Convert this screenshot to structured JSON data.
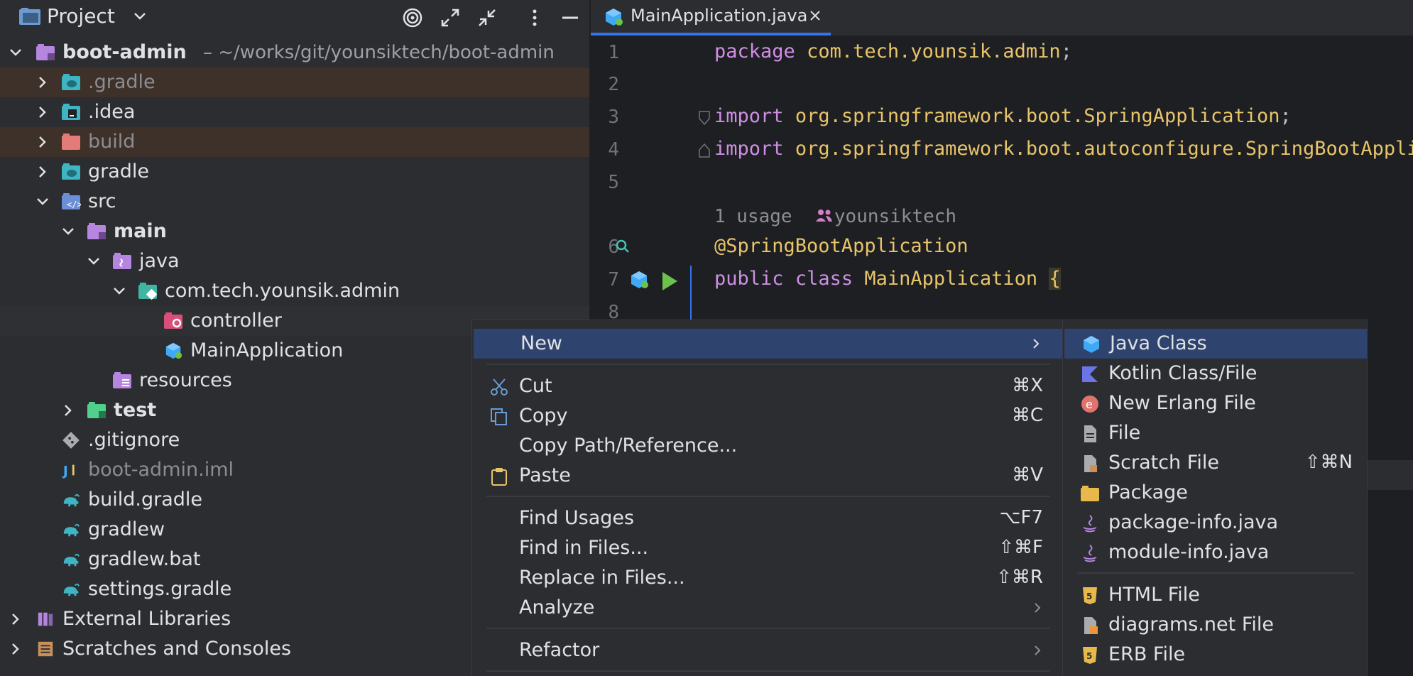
{
  "panel": {
    "title": "Project"
  },
  "tree": [
    {
      "label": "boot-admin",
      "path": "– ~/works/git/younsiktech/boot-admin",
      "bold": true
    },
    {
      "label": ".gradle"
    },
    {
      "label": ".idea"
    },
    {
      "label": "build"
    },
    {
      "label": "gradle"
    },
    {
      "label": "src"
    },
    {
      "label": "main"
    },
    {
      "label": "java"
    },
    {
      "label": "com.tech.younsik.admin"
    },
    {
      "label": "controller"
    },
    {
      "label": "MainApplication"
    },
    {
      "label": "resources"
    },
    {
      "label": "test"
    },
    {
      "label": ".gitignore"
    },
    {
      "label": "boot-admin.iml"
    },
    {
      "label": "build.gradle"
    },
    {
      "label": "gradlew"
    },
    {
      "label": "gradlew.bat"
    },
    {
      "label": "settings.gradle"
    },
    {
      "label": "External Libraries"
    },
    {
      "label": "Scratches and Consoles"
    }
  ],
  "editor": {
    "tab_label": "MainApplication.java",
    "line_numbers": [
      "1",
      "2",
      "3",
      "4",
      "5",
      "6",
      "7",
      "8"
    ],
    "code": {
      "l1_kw": "package",
      "l1_pkg": "com.tech.younsik.admin",
      "l1_end": ";",
      "l3_kw": "import",
      "l3_pkg": "org.springframework.boot.SpringApplication",
      "l3_end": ";",
      "l4_kw": "import",
      "l4_pkg": "org.springframework.boot.autoconfigure.SpringBootApplic",
      "inlay_usage": "1 usage",
      "inlay_author": "younsiktech",
      "l6_annotation": "@SpringBootApplication",
      "l7_kw1": "public",
      "l7_kw2": "class",
      "l7_cls": "MainApplication",
      "l7_brace": "{"
    }
  },
  "context_menu": {
    "new": "New",
    "cut": "Cut",
    "cut_sc": "⌘X",
    "copy": "Copy",
    "copy_sc": "⌘C",
    "copy_path": "Copy Path/Reference...",
    "paste": "Paste",
    "paste_sc": "⌘V",
    "find_usages": "Find Usages",
    "find_usages_sc": "⌥F7",
    "find_files": "Find in Files...",
    "find_files_sc": "⇧⌘F",
    "replace_files": "Replace in Files...",
    "replace_files_sc": "⇧⌘R",
    "analyze": "Analyze",
    "refactor": "Refactor"
  },
  "submenu": {
    "java_class": "Java Class",
    "kotlin": "Kotlin Class/File",
    "erlang": "New Erlang File",
    "file": "File",
    "scratch": "Scratch File",
    "scratch_sc": "⇧⌘N",
    "package": "Package",
    "package_info": "package-info.java",
    "module_info": "module-info.java",
    "html": "HTML File",
    "diagrams": "diagrams.net File",
    "erb": "ERB File"
  },
  "colors": {
    "accent": "#3574f0",
    "selection": "#2e436e",
    "keyword": "#cf8ee5",
    "type": "#e8c46a"
  }
}
